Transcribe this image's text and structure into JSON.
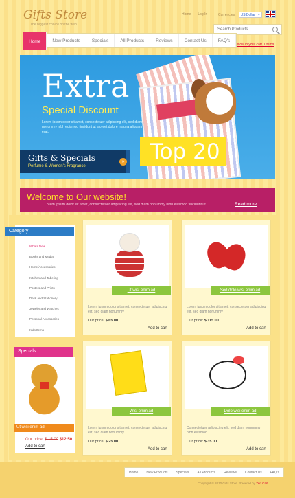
{
  "header": {
    "logo": "Gifts Store",
    "tagline": "The biggest choice on the web",
    "top_links": [
      "Home",
      "Log In"
    ],
    "currency_label": "Currencies:",
    "currency_value": "US Dollar",
    "search_placeholder": "Search Products",
    "cart_link": "Shopping Cart: Now in your cart 0 items"
  },
  "nav": [
    "Home",
    "New Products",
    "Specials",
    "All Products",
    "Reviews",
    "Contact Us",
    "FAQ's"
  ],
  "banner": {
    "title": "Extra",
    "subtitle": "Special Discount",
    "text": "Lorem ipsum dolor sit amet, consectetuer adipiscing elit, sed diam nonummy nibh euismod tincidunt ut laoreet dolore magna aliquam erat.",
    "badge": "Top 20",
    "strip_title": "Gifts & Specials",
    "strip_sub": "Perfume & Women's Fragrance"
  },
  "welcome": {
    "title": "Welcome to Our website!",
    "text": "Lorem ipsum dolor sit amet, consectetuer adipiscing elit, sed diam nonummy nibh euismod tincidunt ut",
    "read_more": "Read more"
  },
  "category": {
    "title": "Category",
    "items": [
      "Whats New",
      "Books and Media",
      "Home/Accessories",
      "Kitchen and Tabeling",
      "Posters and Prints",
      "Desk and Stationery",
      "Jewelry and Watches",
      "Personal Accessories",
      "Kids Items"
    ]
  },
  "specials": {
    "title": "Specials",
    "name": "Ut wisi enim ad",
    "price_label": "Our price:",
    "old_price": "$ 15.00",
    "new_price": "$12.50",
    "cart": "Add to cart"
  },
  "products": [
    {
      "name": "Ut wisi enim ad",
      "desc": "Lorem ipsum dolor sit amet, consectetuer adipiscing elit, sed diam nonummy",
      "price_label": "Our price:",
      "price": "$ 65.00",
      "cart": "Add to cart"
    },
    {
      "name": "Sed dolo wisi enim ad",
      "desc": "Lorem ipsum dolor sit amet, consectetuer adipiscing elit, sed diam nonummy",
      "price_label": "Our price:",
      "price": "$ 115.00",
      "cart": "Add to cart"
    },
    {
      "name": "Wisi enim ad",
      "desc": "Lorem ipsum dolor sit amet, consectetuer adipiscing elit, sed diam nonummy",
      "price_label": "Our price:",
      "price": "$ 25.00",
      "cart": "Add to cart"
    },
    {
      "name": "Dolo wisi enim ad",
      "desc": "Consectetuer adipiscing elit, sed diam nonummy nibh euismod",
      "price_label": "Our price:",
      "price": "$ 35.00",
      "cart": "Add to cart"
    }
  ],
  "footer": {
    "nav": [
      "Home",
      "New Products",
      "Specials",
      "All Products",
      "Reviews",
      "Contact Us",
      "FAQ's"
    ],
    "copyright": "Copyright © 2010 Gifts Store. Powered by",
    "copyright_link": "Zen Cart"
  }
}
